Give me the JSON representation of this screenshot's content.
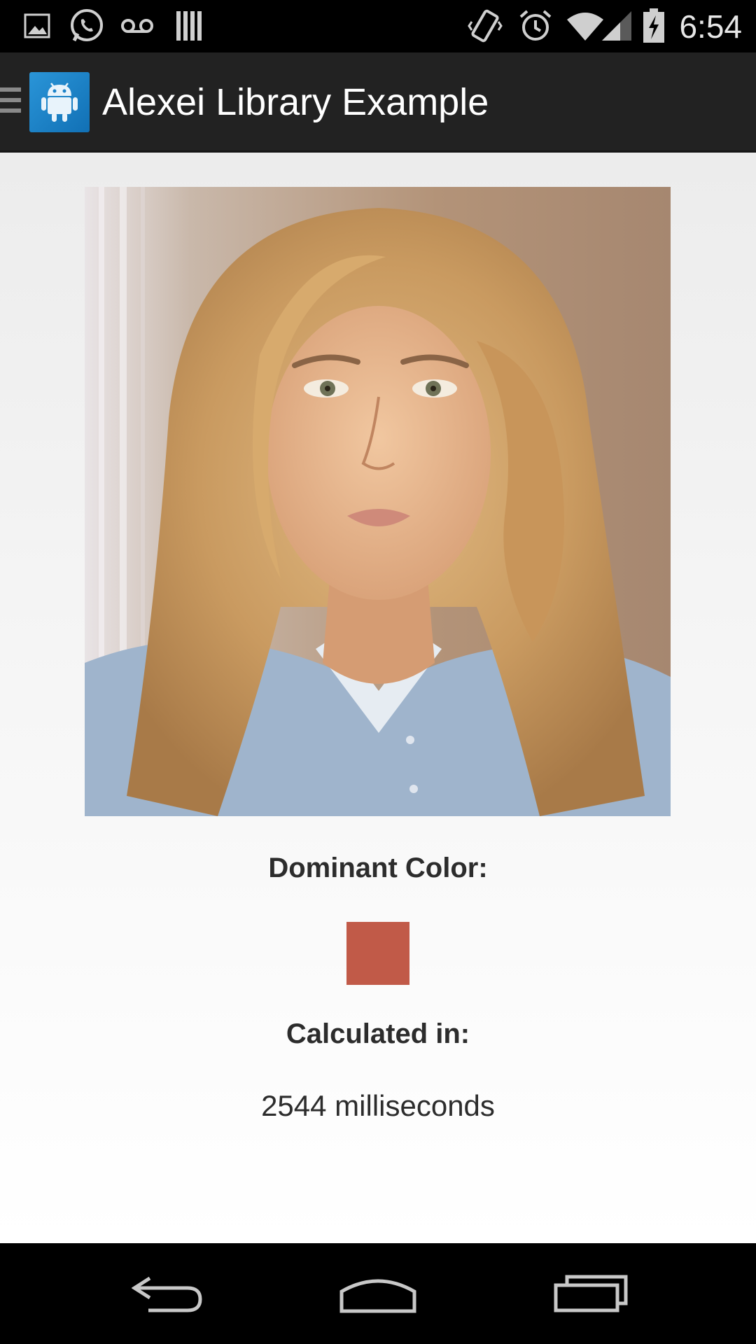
{
  "status_bar": {
    "time": "6:54",
    "icons": [
      "gallery-icon",
      "whatsapp-icon",
      "voicemail-icon",
      "barcode-icon",
      "vibrate-icon",
      "alarm-icon",
      "wifi-icon",
      "signal-icon",
      "battery-charging-icon"
    ]
  },
  "action_bar": {
    "title": "Alexei Library Example",
    "app_icon": "android-icon",
    "drawer_icon": "drawer-icon"
  },
  "content": {
    "dominant_label": "Dominant Color:",
    "dominant_color": "#c15a48",
    "calculated_label": "Calculated in:",
    "calculated_value": "2544 milliseconds"
  },
  "nav_bar": {
    "buttons": [
      "back-icon",
      "home-icon",
      "recents-icon"
    ]
  },
  "colors": {
    "status_bar_bg": "#000000",
    "action_bar_bg": "#222222",
    "app_icon_accent": "#1d82c9",
    "nav_bar_bg": "#000000"
  }
}
